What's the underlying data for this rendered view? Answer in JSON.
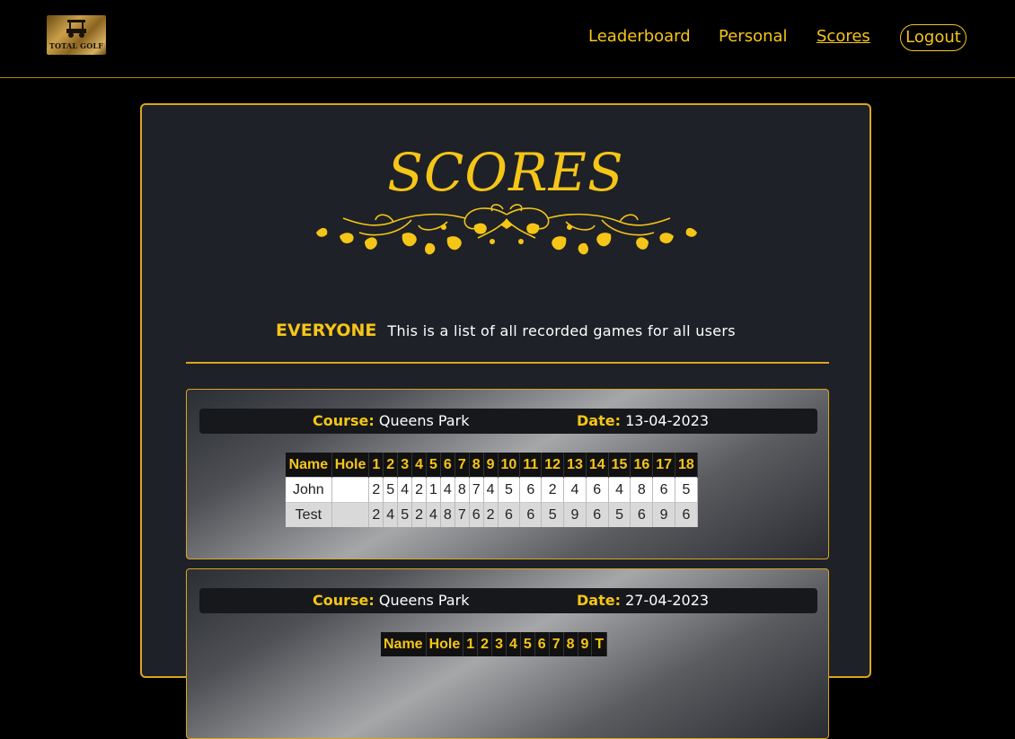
{
  "nav": {
    "logo_text": "TOTAL GOLF",
    "links": [
      "Leaderboard",
      "Personal",
      "Scores"
    ],
    "logout": "Logout"
  },
  "page": {
    "title": "SCORES",
    "filter_label": "EVERYONE",
    "filter_text": "This is a list of all recorded games for all users"
  },
  "games": [
    {
      "course_label": "Course:",
      "course": "Queens Park",
      "date_label": "Date:",
      "date": "13-04-2023",
      "columns": [
        "Name",
        "Hole",
        "1",
        "2",
        "3",
        "4",
        "5",
        "6",
        "7",
        "8",
        "9",
        "10",
        "11",
        "12",
        "13",
        "14",
        "15",
        "16",
        "17",
        "18"
      ],
      "rows": [
        {
          "name": "John",
          "hole": "",
          "scores": [
            "2",
            "5",
            "4",
            "2",
            "1",
            "4",
            "8",
            "7",
            "4",
            "5",
            "6",
            "2",
            "4",
            "6",
            "4",
            "8",
            "6",
            "5"
          ]
        },
        {
          "name": "Test",
          "hole": "",
          "scores": [
            "2",
            "4",
            "5",
            "2",
            "4",
            "8",
            "7",
            "6",
            "2",
            "6",
            "6",
            "5",
            "9",
            "6",
            "5",
            "6",
            "9",
            "6"
          ]
        }
      ]
    },
    {
      "course_label": "Course:",
      "course": "Queens Park",
      "date_label": "Date:",
      "date": "27-04-2023",
      "columns": [
        "Name",
        "Hole",
        "1",
        "2",
        "3",
        "4",
        "5",
        "6",
        "7",
        "8",
        "9",
        "T"
      ],
      "rows": []
    }
  ],
  "colors": {
    "accent": "#f5c518",
    "border": "#d9a520",
    "panel": "#1e2127",
    "background": "#000000"
  }
}
